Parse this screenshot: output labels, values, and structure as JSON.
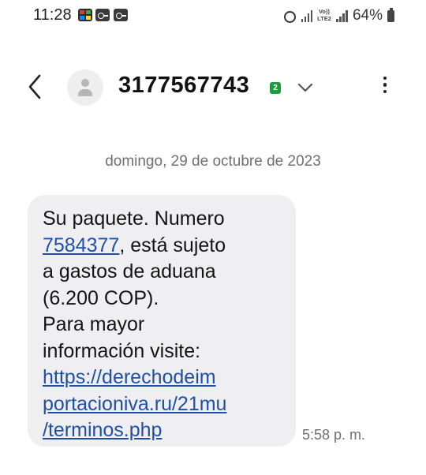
{
  "status_bar": {
    "time": "11:28",
    "battery": "64%",
    "network_label": "Vo)) LTE2",
    "icons": [
      "app-notification-icon",
      "voicemail-icon",
      "voicemail-icon",
      "alarm-icon",
      "signal-icon",
      "volte-icon",
      "signal-icon",
      "battery-icon"
    ]
  },
  "header": {
    "contact_number": "3177567743",
    "sim_badge": "2",
    "icons": [
      "back-arrow-icon",
      "avatar-icon",
      "chevron-down-icon",
      "more-vertical-icon"
    ]
  },
  "conversation": {
    "date_separator": "domingo, 29 de octubre de 2023",
    "message": {
      "line1": "Su paquete. Numero",
      "link1": "7584377",
      "line2_rest": ", está sujeto",
      "line3": "a gastos de aduana",
      "line4": "(6.200 COP).",
      "line5": "Para mayor",
      "line6": "información visite:",
      "link2_line1": "https://derechodeim",
      "link2_line2": "portacioniva.ru/21mu",
      "link2_line3": "/terminos.php",
      "time": "5:58 p. m."
    }
  },
  "colors": {
    "bubble": "#efeff1",
    "link": "#1f4fa8",
    "sim_badge": "#1f9a3e",
    "secondary_text": "#6f6f6f"
  }
}
